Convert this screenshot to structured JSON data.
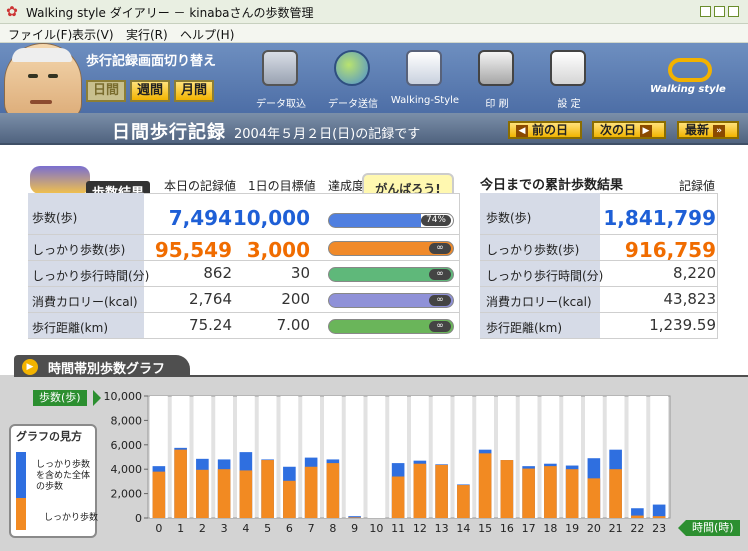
{
  "window": {
    "title": "Walking style ダイアリー － kinabaさんの歩数管理"
  },
  "menu": [
    "ファイル(F)",
    "表示(V)",
    "実行(R)",
    "ヘルプ(H)"
  ],
  "toolbar": {
    "switch_label": "歩行記録画面切り替え",
    "switch_buttons": [
      "日間",
      "週間",
      "月間"
    ],
    "tools": [
      {
        "label": "データ取込",
        "icon": "computer-import-icon"
      },
      {
        "label": "データ送信",
        "icon": "globe-send-icon"
      },
      {
        "label": "Walking-Style",
        "icon": "documents-icon"
      },
      {
        "label": "印 刷",
        "icon": "printer-icon"
      },
      {
        "label": "設 定",
        "icon": "settings-clipboard-icon"
      }
    ],
    "brand": "Walking style"
  },
  "header": {
    "title": "日間歩行記録",
    "date_text": "2004年５月２日(日)の記録です",
    "prev_day": "前の日",
    "next_day": "次の日",
    "latest": "最新"
  },
  "daily": {
    "title": "歩数結果",
    "col_record": "本日の記録値",
    "col_goal": "1日の目標値",
    "col_achieve": "達成度",
    "cheer": "がんばろう!",
    "rows": [
      {
        "label": "歩数(歩)",
        "value": "7,494",
        "goal": "10,000",
        "achieve_pct": 74,
        "achieve_text": "74%",
        "color": "#1e5fd6"
      },
      {
        "label": "しっかり歩数(歩)",
        "value": "95,549",
        "goal": "3,000",
        "achieve_pct": 100,
        "achieve_text": "∞",
        "color": "#f06c00"
      },
      {
        "label": "しっかり歩行時間(分)",
        "value": "862",
        "goal": "30",
        "achieve_pct": 100,
        "achieve_text": "∞",
        "color": "#333333"
      },
      {
        "label": "消費カロリー(kcal)",
        "value": "2,764",
        "goal": "200",
        "achieve_pct": 100,
        "achieve_text": "∞",
        "color": "#333333"
      },
      {
        "label": "歩行距離(km)",
        "value": "75.24",
        "goal": "7.00",
        "achieve_pct": 100,
        "achieve_text": "∞",
        "color": "#333333"
      }
    ],
    "bar_colors": [
      "#4f7fe0",
      "#f08a2a",
      "#5fb87a",
      "#8f91d8",
      "#6ab55a"
    ]
  },
  "cumulative": {
    "title": "今日までの累計歩数結果",
    "col_record": "記録値",
    "rows": [
      {
        "label": "歩数(歩)",
        "value": "1,841,799",
        "color": "#1e5fd6"
      },
      {
        "label": "しっかり歩数(歩)",
        "value": "916,759",
        "color": "#f06c00"
      },
      {
        "label": "しっかり歩行時間(分)",
        "value": "8,220",
        "color": "#333333"
      },
      {
        "label": "消費カロリー(kcal)",
        "value": "43,823",
        "color": "#333333"
      },
      {
        "label": "歩行距離(km)",
        "value": "1,239.59",
        "color": "#333333"
      }
    ]
  },
  "graph": {
    "title": "時間帯別歩数グラフ",
    "y_tag": "歩数(歩)",
    "x_tag": "時間(時)",
    "guide_title": "グラフの見方",
    "guide_total": "しっかり歩数を含めた全体の歩数",
    "guide_firm": "しっかり歩数"
  },
  "chart_data": {
    "type": "bar",
    "categories": [
      "0",
      "1",
      "2",
      "3",
      "4",
      "5",
      "6",
      "7",
      "8",
      "9",
      "10",
      "11",
      "12",
      "13",
      "14",
      "15",
      "16",
      "17",
      "18",
      "19",
      "20",
      "21",
      "22",
      "23"
    ],
    "series": [
      {
        "name": "しっかり歩数",
        "values": [
          3800,
          5600,
          3950,
          4000,
          3900,
          4750,
          3050,
          4200,
          4500,
          50,
          0,
          3400,
          4450,
          4350,
          2700,
          5300,
          4750,
          4050,
          4250,
          4000,
          3250,
          4000,
          200,
          150
        ]
      },
      {
        "name": "全体の歩数",
        "values": [
          4250,
          5750,
          4850,
          4800,
          5400,
          4800,
          4200,
          4950,
          4800,
          150,
          0,
          4500,
          4700,
          4400,
          2750,
          5600,
          4750,
          4250,
          4450,
          4300,
          4900,
          5600,
          800,
          1100
        ]
      }
    ],
    "yticks": [
      "0",
      "2,000",
      "4,000",
      "6,000",
      "8,000",
      "10,000"
    ],
    "ylim": [
      0,
      10000
    ],
    "colors": {
      "firm": "#f28a22",
      "total": "#2f6fe0"
    }
  }
}
